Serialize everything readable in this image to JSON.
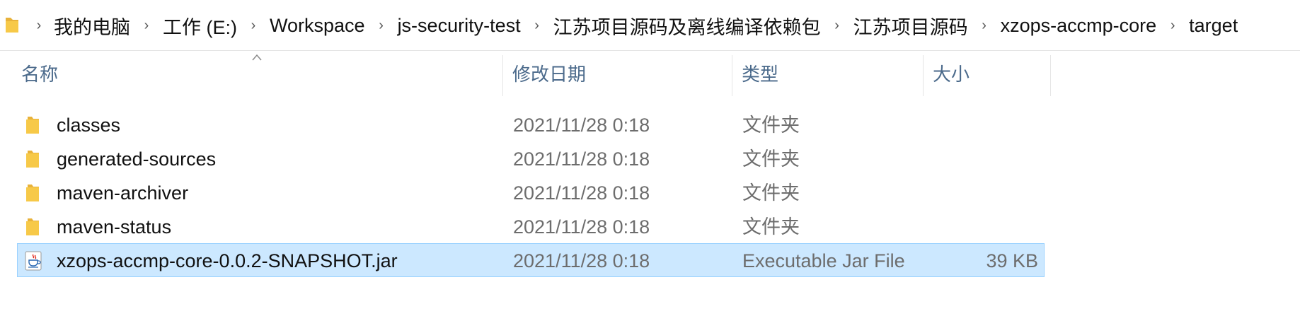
{
  "address_bar": {
    "breadcrumbs": [
      "我的电脑",
      "工作 (E:)",
      "Workspace",
      "js-security-test",
      "江苏项目源码及离线编译依赖包",
      "江苏项目源码",
      "xzops-accmp-core",
      "target"
    ]
  },
  "columns": {
    "name": "名称",
    "date_modified": "修改日期",
    "type": "类型",
    "size": "大小"
  },
  "files": [
    {
      "name": "classes",
      "date": "2021/11/28 0:18",
      "type": "文件夹",
      "size": "",
      "icon": "folder-icon"
    },
    {
      "name": "generated-sources",
      "date": "2021/11/28 0:18",
      "type": "文件夹",
      "size": "",
      "icon": "folder-icon"
    },
    {
      "name": "maven-archiver",
      "date": "2021/11/28 0:18",
      "type": "文件夹",
      "size": "",
      "icon": "folder-icon"
    },
    {
      "name": "maven-status",
      "date": "2021/11/28 0:18",
      "type": "文件夹",
      "size": "",
      "icon": "folder-icon"
    },
    {
      "name": "xzops-accmp-core-0.0.2-SNAPSHOT.jar",
      "date": "2021/11/28 0:18",
      "type": "Executable Jar File",
      "size": "39 KB",
      "icon": "java-jar-icon",
      "selected": true
    }
  ],
  "colors": {
    "selection_bg": "#cce8ff",
    "selection_border": "#99d1ff",
    "header_text": "#4b6a8b",
    "folder_yellow": "#f7c948"
  }
}
